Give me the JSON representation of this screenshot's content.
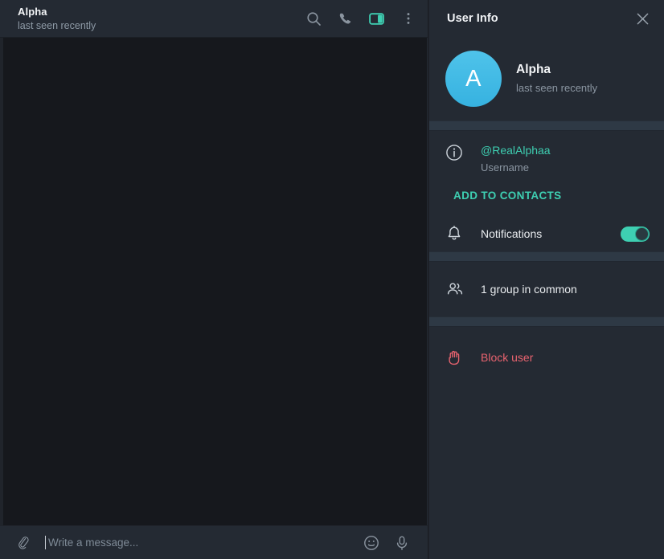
{
  "colors": {
    "accent": "#3ecfb2",
    "avatar": "#41bce4",
    "danger": "#e8636f",
    "panel_bg": "#242a33",
    "canvas_bg": "#16181d",
    "divider": "#2e3945"
  },
  "chat": {
    "title": "Alpha",
    "subtitle": "last seen recently",
    "header_actions": [
      {
        "name": "search-icon",
        "label": "Search"
      },
      {
        "name": "phone-icon",
        "label": "Call"
      },
      {
        "name": "sidebar-panel-icon",
        "label": "Toggle Info Panel",
        "active": true
      },
      {
        "name": "more-vertical-icon",
        "label": "More"
      }
    ],
    "composer": {
      "attach_icon": "paperclip-icon",
      "placeholder": "Write a message...",
      "value": "",
      "emoji_icon": "smiley-icon",
      "voice_icon": "microphone-icon"
    }
  },
  "info_panel": {
    "header_title": "User Info",
    "close_icon": "close-icon",
    "profile": {
      "avatar_initial": "A",
      "name": "Alpha",
      "status": "last seen recently"
    },
    "username": {
      "icon": "info-circle-icon",
      "value": "@RealAlphaa",
      "label": "Username"
    },
    "add_to_contacts": "ADD TO CONTACTS",
    "notifications": {
      "icon": "bell-icon",
      "label": "Notifications",
      "enabled": true
    },
    "groups_in_common": {
      "icon": "people-icon",
      "label": "1 group in common"
    },
    "block_user": {
      "icon": "hand-stop-icon",
      "label": "Block user"
    }
  }
}
